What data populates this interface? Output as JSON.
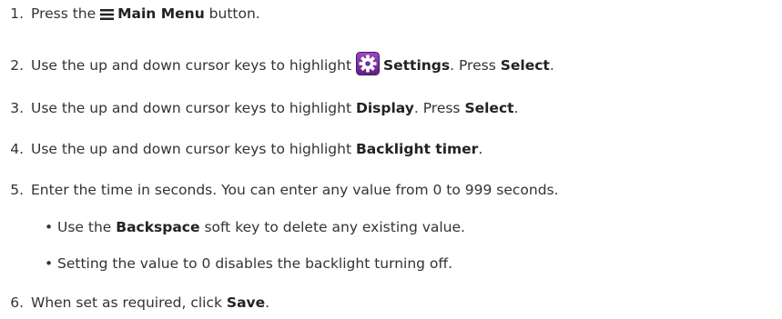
{
  "steps": [
    {
      "number": "1.",
      "pre": "Press the ",
      "icon": "main-menu-icon",
      "bold": "Main Menu",
      "post": " button."
    },
    {
      "number": "2.",
      "pre": "Use the up and down cursor keys to highlight ",
      "icon": "settings-gear-icon",
      "bold": "Settings",
      "mid": ". Press ",
      "bold2": "Select",
      "post": "."
    },
    {
      "number": "3.",
      "pre": "Use the up and down cursor keys to highlight ",
      "bold": "Display",
      "mid": ". Press ",
      "bold2": "Select",
      "post": "."
    },
    {
      "number": "4.",
      "pre": "Use the up and down cursor keys to highlight ",
      "bold": "Backlight timer",
      "post": "."
    },
    {
      "number": "5.",
      "text": "Enter the time in seconds. You can enter any value from 0 to 999 seconds.",
      "bullets": [
        {
          "pre": "Use the ",
          "bold": "Backspace",
          "post": " soft key to delete any existing value."
        },
        {
          "text": "Setting the value to 0 disables the backlight turning off."
        }
      ]
    },
    {
      "number": "6.",
      "pre": "When set as required, click ",
      "bold": "Save",
      "post": "."
    }
  ],
  "bullet_char": "•",
  "colors": {
    "text": "#333333",
    "gear_bg": "#7a2fa0"
  }
}
